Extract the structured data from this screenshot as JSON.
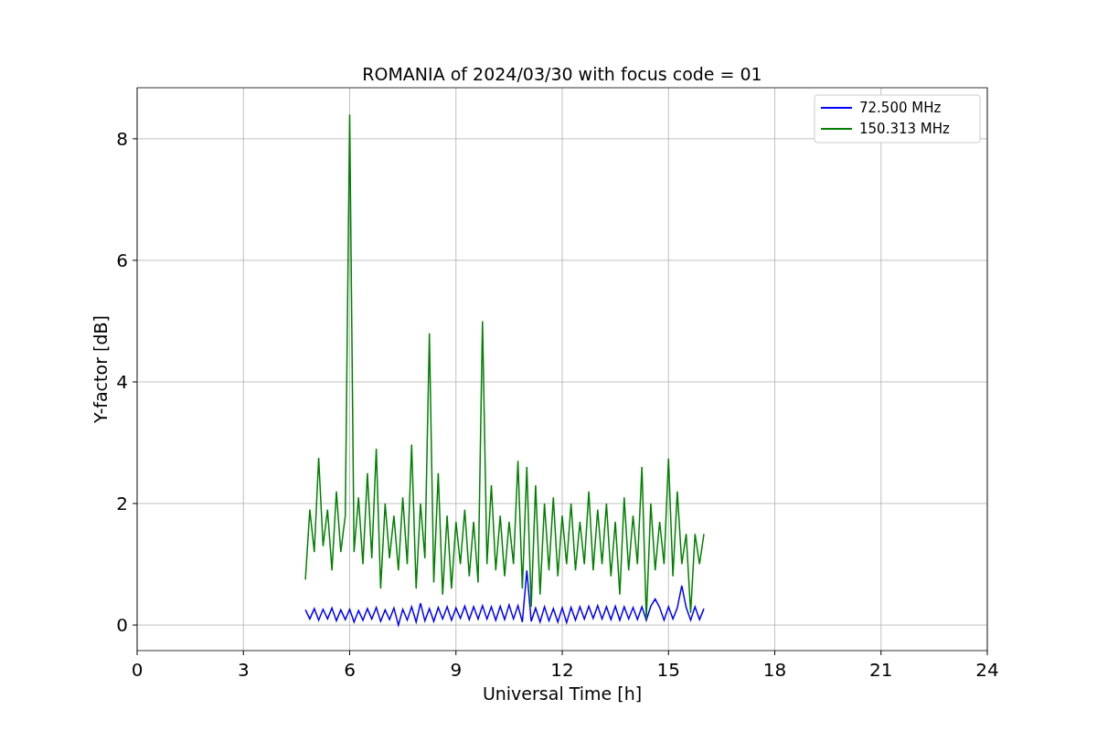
{
  "chart_data": {
    "type": "line",
    "title": "ROMANIA of 2024/03/30 with focus code = 01",
    "xlabel": "Universal Time [h]",
    "ylabel": "Y-factor [dB]",
    "x": [
      4.75,
      4.875,
      5,
      5.125,
      5.25,
      5.375,
      5.5,
      5.625,
      5.75,
      5.875,
      6,
      6.125,
      6.25,
      6.375,
      6.5,
      6.625,
      6.75,
      6.875,
      7,
      7.125,
      7.25,
      7.375,
      7.5,
      7.625,
      7.75,
      7.875,
      8,
      8.125,
      8.25,
      8.375,
      8.5,
      8.625,
      8.75,
      8.875,
      9,
      9.125,
      9.25,
      9.375,
      9.5,
      9.625,
      9.75,
      9.875,
      10,
      10.125,
      10.25,
      10.375,
      10.5,
      10.625,
      10.75,
      10.875,
      11,
      11.125,
      11.25,
      11.375,
      11.5,
      11.625,
      11.75,
      11.875,
      12,
      12.125,
      12.25,
      12.375,
      12.5,
      12.625,
      12.75,
      12.875,
      13,
      13.125,
      13.25,
      13.375,
      13.5,
      13.625,
      13.75,
      13.875,
      14,
      14.125,
      14.25,
      14.375,
      14.5,
      14.625,
      14.75,
      14.875,
      15,
      15.125,
      15.25,
      15.375,
      15.5,
      15.625,
      15.75,
      15.875,
      16
    ],
    "series": [
      {
        "name": "72.500 MHz",
        "color": "#0000ff",
        "values": [
          0.25,
          0.1,
          0.27,
          0.08,
          0.26,
          0.1,
          0.28,
          0.07,
          0.25,
          0.09,
          0.26,
          0.05,
          0.24,
          0.08,
          0.27,
          0.1,
          0.29,
          0.06,
          0.25,
          0.09,
          0.28,
          0.0,
          0.26,
          0.08,
          0.3,
          0.05,
          0.36,
          0.07,
          0.27,
          0.06,
          0.29,
          0.1,
          0.3,
          0.08,
          0.28,
          0.11,
          0.31,
          0.09,
          0.3,
          0.1,
          0.32,
          0.1,
          0.3,
          0.08,
          0.31,
          0.09,
          0.33,
          0.1,
          0.32,
          0.05,
          0.9,
          0.06,
          0.28,
          0.05,
          0.3,
          0.07,
          0.27,
          0.05,
          0.28,
          0.04,
          0.29,
          0.08,
          0.3,
          0.1,
          0.31,
          0.11,
          0.32,
          0.1,
          0.3,
          0.09,
          0.31,
          0.08,
          0.3,
          0.1,
          0.29,
          0.09,
          0.3,
          0.08,
          0.31,
          0.43,
          0.29,
          0.08,
          0.3,
          0.1,
          0.28,
          0.65,
          0.29,
          0.08,
          0.3,
          0.09,
          0.27
        ]
      },
      {
        "name": "150.313 MHz",
        "color": "#008000",
        "values": [
          0.75,
          1.9,
          1.2,
          2.75,
          1.3,
          1.9,
          0.9,
          2.2,
          1.2,
          1.8,
          8.4,
          1.2,
          2.1,
          1.0,
          2.5,
          1.1,
          2.9,
          0.6,
          2.0,
          1.1,
          1.8,
          0.9,
          2.1,
          1.0,
          2.97,
          0.6,
          2.0,
          1.1,
          4.8,
          0.7,
          2.5,
          0.5,
          1.8,
          0.6,
          1.7,
          1.0,
          1.9,
          0.8,
          1.7,
          0.7,
          5.0,
          1.0,
          2.3,
          0.9,
          1.8,
          0.8,
          1.7,
          1.0,
          2.7,
          0.6,
          2.6,
          0.3,
          2.3,
          0.5,
          2.0,
          0.9,
          2.1,
          0.8,
          1.8,
          1.0,
          2.0,
          0.9,
          1.7,
          1.0,
          2.2,
          0.9,
          1.9,
          1.0,
          2.0,
          0.8,
          1.7,
          0.5,
          2.1,
          0.9,
          1.8,
          1.0,
          2.6,
          0.1,
          2.0,
          0.9,
          1.7,
          1.0,
          2.74,
          0.8,
          2.2,
          1.0,
          1.5,
          0.2,
          1.5,
          1.0,
          1.5
        ]
      }
    ],
    "xlim": [
      0,
      24
    ],
    "ylim": [
      -0.42,
      8.84
    ],
    "xticks": [
      0,
      3,
      6,
      9,
      12,
      15,
      18,
      21,
      24
    ],
    "yticks": [
      0,
      2,
      4,
      6,
      8
    ],
    "grid": true,
    "legend": true
  }
}
